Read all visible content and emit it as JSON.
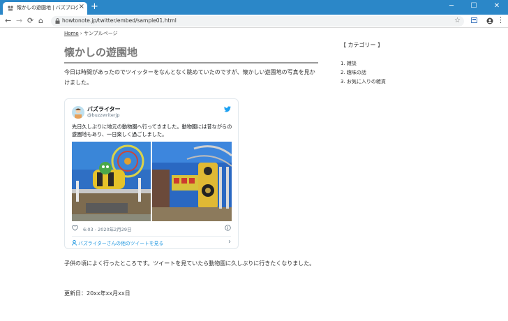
{
  "browser": {
    "tab_title": "懐かしの遊園地 | バズブログ",
    "new_tab": "+",
    "close_tab": "×",
    "url": "howtonote.jp/twitter/embed/sample01.html",
    "controls": {
      "minimize": "─",
      "maximize": "☐",
      "close": "✕"
    },
    "nav": {
      "back": "←",
      "forward": "→",
      "reload": "⟳",
      "home": "⌂"
    },
    "star": "☆",
    "menu": "⋮"
  },
  "page": {
    "breadcrumb": {
      "home": "Home",
      "sep": "›",
      "current": "サンプルページ"
    },
    "title": "懐かしの遊園地",
    "paragraph1": "今日は時間があったのでツイッターをなんとなく眺めていたのですが、懐かしい遊園地の写真を見かけました。",
    "paragraph2": "子供の頃によく行ったところです。ツイートを見ていたら動物園に久しぶりに行きたくなりました。",
    "updated": "更新日：20xx年xx月xx日"
  },
  "tweet": {
    "name": "バズライター",
    "handle": "@buzzwriterjp",
    "text": "先日久しぶりに地元の動物園へ行ってきました。動物園には昔ながらの遊園地もあり、一日楽しく過ごしました。",
    "time": "6:03 - 2020年2月29日",
    "more": "バズライターさんの他のツイートを見る",
    "chevron": "›"
  },
  "sidebar": {
    "heading": "【 カテゴリー 】",
    "items": [
      "1. 雑談",
      "2. 趣味の話",
      "3. お気に入りの雑貨"
    ]
  },
  "colors": {
    "titlebar": "#2b87c8",
    "twitter_blue": "#1da1f2",
    "link": "#1b95e0"
  }
}
